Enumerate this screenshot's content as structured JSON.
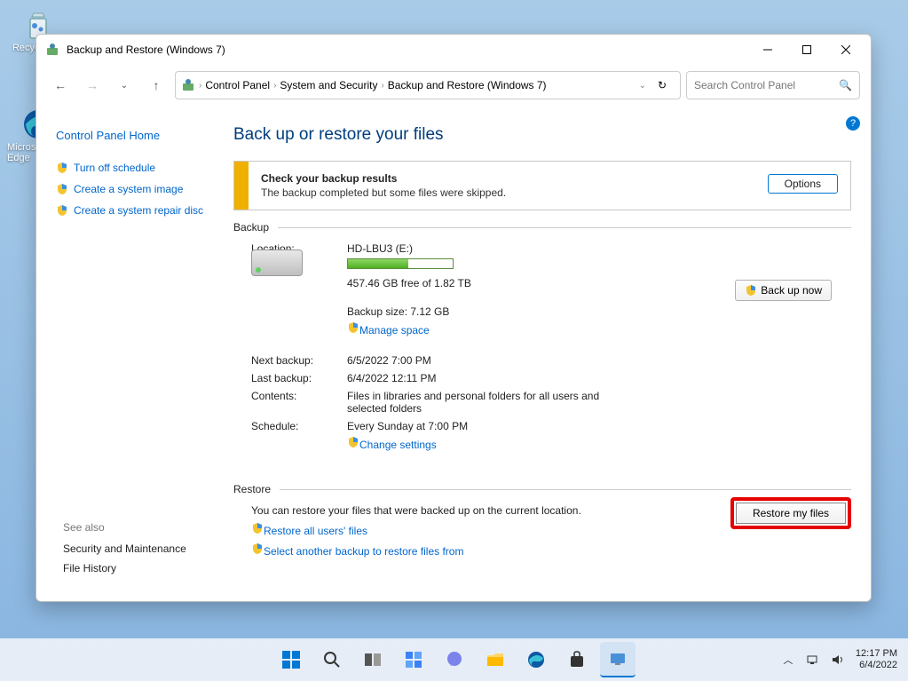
{
  "desktop": {
    "recycle": "Recycle Bin",
    "edge": "Microsoft Edge"
  },
  "window": {
    "title": "Backup and Restore (Windows 7)",
    "breadcrumb": [
      "Control Panel",
      "System and Security",
      "Backup and Restore (Windows 7)"
    ],
    "search_placeholder": "Search Control Panel"
  },
  "sidebar": {
    "home": "Control Panel Home",
    "links": [
      "Turn off schedule",
      "Create a system image",
      "Create a system repair disc"
    ],
    "seealso_hdr": "See also",
    "seealso": [
      "Security and Maintenance",
      "File History"
    ]
  },
  "main": {
    "heading": "Back up or restore your files",
    "alert_title": "Check your backup results",
    "alert_body": "The backup completed but some files were skipped.",
    "options_btn": "Options",
    "backup_hdr": "Backup",
    "backupnow_btn": "Back up now",
    "location_lbl": "Location:",
    "location_val": "HD-LBU3 (E:)",
    "freespace": "457.46 GB free of 1.82 TB",
    "backupsize": "Backup size: 7.12 GB",
    "managespace": "Manage space",
    "progress_pct": 58,
    "next_lbl": "Next backup:",
    "next_val": "6/5/2022 7:00 PM",
    "last_lbl": "Last backup:",
    "last_val": "6/4/2022 12:11 PM",
    "contents_lbl": "Contents:",
    "contents_val": "Files in libraries and personal folders for all users and selected folders",
    "sched_lbl": "Schedule:",
    "sched_val": "Every Sunday at 7:00 PM",
    "changesettings": "Change settings",
    "restore_hdr": "Restore",
    "restore_desc": "You can restore your files that were backed up on the current location.",
    "restore_btn": "Restore my files",
    "restore_all": "Restore all users' files",
    "restore_other": "Select another backup to restore files from"
  },
  "taskbar": {
    "time": "12:17 PM",
    "date": "6/4/2022"
  }
}
